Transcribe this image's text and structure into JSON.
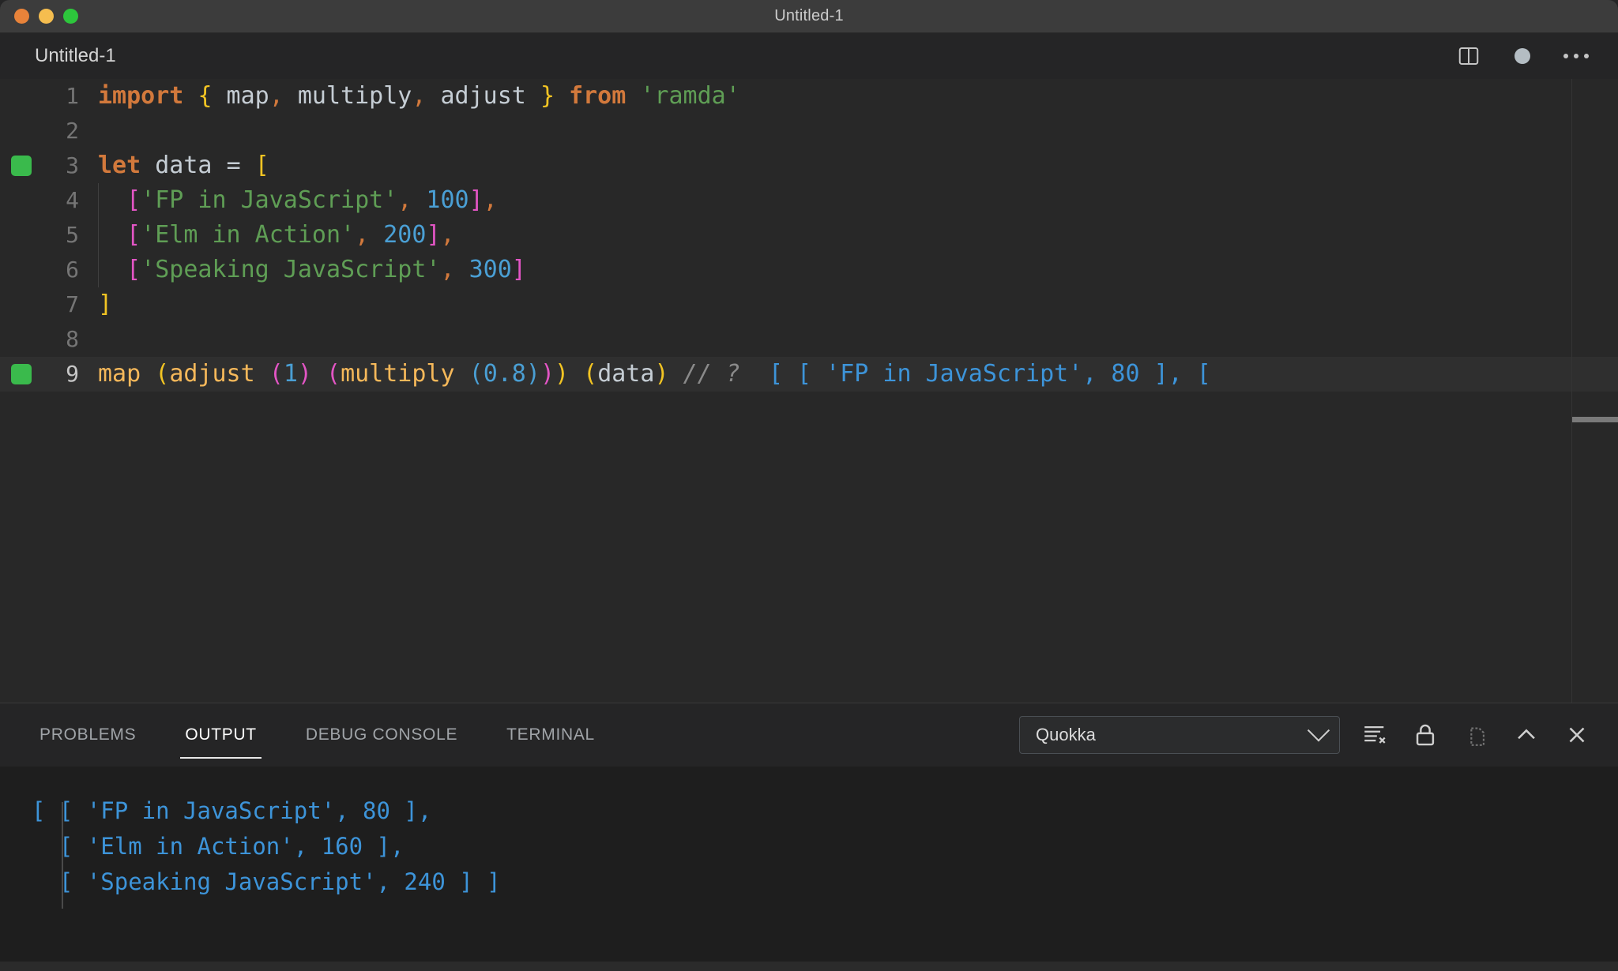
{
  "window": {
    "title": "Untitled-1",
    "traffic_lights": [
      "close-button",
      "minimize-button",
      "maximize-button"
    ]
  },
  "editor_tab": {
    "label": "Untitled-1",
    "actions": [
      "split-editor-icon",
      "unsaved-dot-icon",
      "more-actions-icon"
    ]
  },
  "code": {
    "lines": [
      {
        "number": "1",
        "marker": false,
        "tokens": [
          {
            "t": "import",
            "c": "t-kw"
          },
          {
            "t": " ",
            "c": "t-plain"
          },
          {
            "t": "{",
            "c": "t-b1"
          },
          {
            "t": " map",
            "c": "t-plain"
          },
          {
            "t": ",",
            "c": "t-comma"
          },
          {
            "t": " multiply",
            "c": "t-plain"
          },
          {
            "t": ",",
            "c": "t-comma"
          },
          {
            "t": " adjust ",
            "c": "t-plain"
          },
          {
            "t": "}",
            "c": "t-b1"
          },
          {
            "t": " ",
            "c": "t-plain"
          },
          {
            "t": "from",
            "c": "t-kw"
          },
          {
            "t": " ",
            "c": "t-plain"
          },
          {
            "t": "'ramda'",
            "c": "t-str"
          }
        ]
      },
      {
        "number": "2",
        "marker": false,
        "tokens": []
      },
      {
        "number": "3",
        "marker": true,
        "tokens": [
          {
            "t": "let",
            "c": "t-kw"
          },
          {
            "t": " data ",
            "c": "t-plain"
          },
          {
            "t": "=",
            "c": "t-plain"
          },
          {
            "t": " ",
            "c": "t-plain"
          },
          {
            "t": "[",
            "c": "t-b1"
          }
        ]
      },
      {
        "number": "4",
        "marker": false,
        "indent": true,
        "tokens": [
          {
            "t": "  ",
            "c": "t-plain"
          },
          {
            "t": "[",
            "c": "t-b2"
          },
          {
            "t": "'FP in JavaScript'",
            "c": "t-str"
          },
          {
            "t": ",",
            "c": "t-comma"
          },
          {
            "t": " ",
            "c": "t-plain"
          },
          {
            "t": "100",
            "c": "t-num"
          },
          {
            "t": "]",
            "c": "t-b2"
          },
          {
            "t": ",",
            "c": "t-comma"
          }
        ]
      },
      {
        "number": "5",
        "marker": false,
        "indent": true,
        "tokens": [
          {
            "t": "  ",
            "c": "t-plain"
          },
          {
            "t": "[",
            "c": "t-b2"
          },
          {
            "t": "'Elm in Action'",
            "c": "t-str"
          },
          {
            "t": ",",
            "c": "t-comma"
          },
          {
            "t": " ",
            "c": "t-plain"
          },
          {
            "t": "200",
            "c": "t-num"
          },
          {
            "t": "]",
            "c": "t-b2"
          },
          {
            "t": ",",
            "c": "t-comma"
          }
        ]
      },
      {
        "number": "6",
        "marker": false,
        "indent": true,
        "tokens": [
          {
            "t": "  ",
            "c": "t-plain"
          },
          {
            "t": "[",
            "c": "t-b2"
          },
          {
            "t": "'Speaking JavaScript'",
            "c": "t-str"
          },
          {
            "t": ",",
            "c": "t-comma"
          },
          {
            "t": " ",
            "c": "t-plain"
          },
          {
            "t": "300",
            "c": "t-num"
          },
          {
            "t": "]",
            "c": "t-b2"
          }
        ]
      },
      {
        "number": "7",
        "marker": false,
        "tokens": [
          {
            "t": "]",
            "c": "t-b1"
          }
        ]
      },
      {
        "number": "8",
        "marker": false,
        "tokens": []
      },
      {
        "number": "9",
        "marker": true,
        "active": true,
        "tokens": [
          {
            "t": "map ",
            "c": "t-fn"
          },
          {
            "t": "(",
            "c": "t-b1"
          },
          {
            "t": "adjust ",
            "c": "t-fn"
          },
          {
            "t": "(",
            "c": "t-b2"
          },
          {
            "t": "1",
            "c": "t-num"
          },
          {
            "t": ")",
            "c": "t-b2"
          },
          {
            "t": " ",
            "c": "t-plain"
          },
          {
            "t": "(",
            "c": "t-b2"
          },
          {
            "t": "multiply ",
            "c": "t-fn"
          },
          {
            "t": "(",
            "c": "t-b3"
          },
          {
            "t": "0.8",
            "c": "t-num"
          },
          {
            "t": ")",
            "c": "t-b3"
          },
          {
            "t": ")",
            "c": "t-b2"
          },
          {
            "t": ")",
            "c": "t-b1"
          },
          {
            "t": " ",
            "c": "t-plain"
          },
          {
            "t": "(",
            "c": "t-b1"
          },
          {
            "t": "data",
            "c": "t-plain"
          },
          {
            "t": ")",
            "c": "t-b1"
          },
          {
            "t": " ",
            "c": "t-plain"
          },
          {
            "t": "// ?",
            "c": "t-comment"
          },
          {
            "t": "  ",
            "c": "t-plain"
          },
          {
            "t": "[ [ 'FP in JavaScript', 80 ], [",
            "c": "t-result"
          }
        ]
      }
    ]
  },
  "panel": {
    "tabs": [
      {
        "label": "PROBLEMS",
        "active": false
      },
      {
        "label": "OUTPUT",
        "active": true
      },
      {
        "label": "DEBUG CONSOLE",
        "active": false
      },
      {
        "label": "TERMINAL",
        "active": false
      }
    ],
    "channel_select": {
      "value": "Quokka",
      "options": [
        "Quokka"
      ]
    },
    "actions": [
      "clear-output-icon",
      "lock-scroll-icon",
      "open-in-editor-icon",
      "maximize-panel-icon",
      "close-panel-icon"
    ],
    "output_lines": [
      "[ [ 'FP in JavaScript', 80 ],",
      "  [ 'Elm in Action', 160 ],",
      "  [ 'Speaking JavaScript', 240 ] ]"
    ]
  },
  "colors": {
    "titlebar_bg": "#3c3c3c",
    "editor_bg": "#282828",
    "panel_bg": "#1e1e1e",
    "keyword": "#d2793c",
    "string": "#5f9e55",
    "number": "#4a9fd4",
    "bracket_1": "#f2c423",
    "bracket_2": "#e255c4",
    "bracket_3": "#4a9fd4",
    "comment": "#8a8a8a",
    "quokka_result": "#3d94d9",
    "quokka_marker": "#3aba4c"
  }
}
